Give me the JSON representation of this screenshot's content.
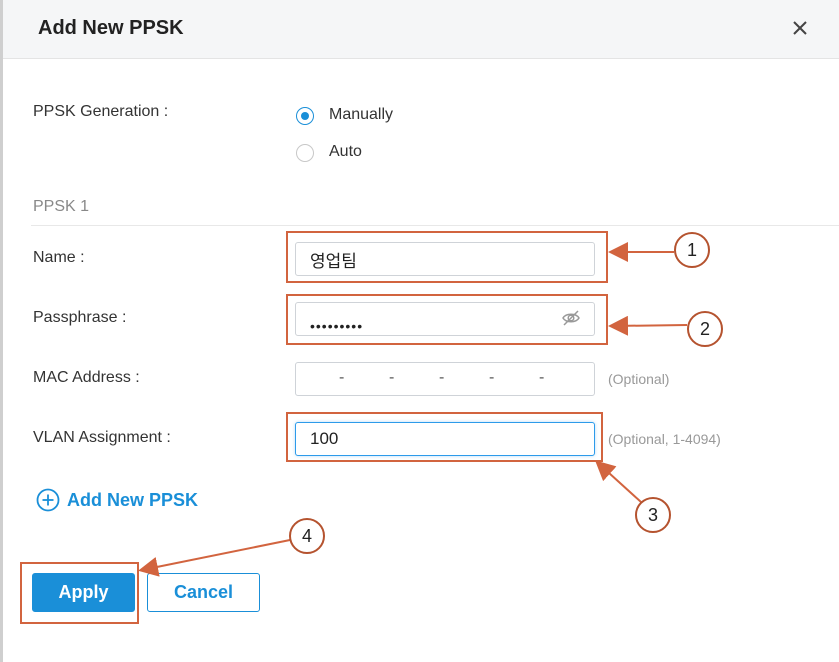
{
  "dialog": {
    "title": "Add New PPSK",
    "close_icon": "close-icon"
  },
  "generation": {
    "label": "PPSK Generation :",
    "options": [
      {
        "label": "Manually",
        "selected": true
      },
      {
        "label": "Auto",
        "selected": false
      }
    ]
  },
  "section": {
    "title": "PPSK 1"
  },
  "fields": {
    "name": {
      "label": "Name :",
      "value": "영업팀"
    },
    "passphrase": {
      "label": "Passphrase :",
      "value": "•••••••••",
      "toggle_icon": "eye-off-icon"
    },
    "mac": {
      "label": "MAC Address :",
      "segments": [
        "-",
        "-",
        "-",
        "-",
        "-"
      ],
      "hint": "(Optional)"
    },
    "vlan": {
      "label": "VLAN Assignment :",
      "value": "100",
      "hint": "(Optional, 1-4094)"
    }
  },
  "add_ppsk": {
    "label": "Add New PPSK",
    "icon": "plus-circle-icon"
  },
  "buttons": {
    "apply": "Apply",
    "cancel": "Cancel"
  },
  "callouts": [
    "1",
    "2",
    "3",
    "4"
  ],
  "colors": {
    "accent": "#1a8fd8",
    "annotation": "#d2643f"
  }
}
